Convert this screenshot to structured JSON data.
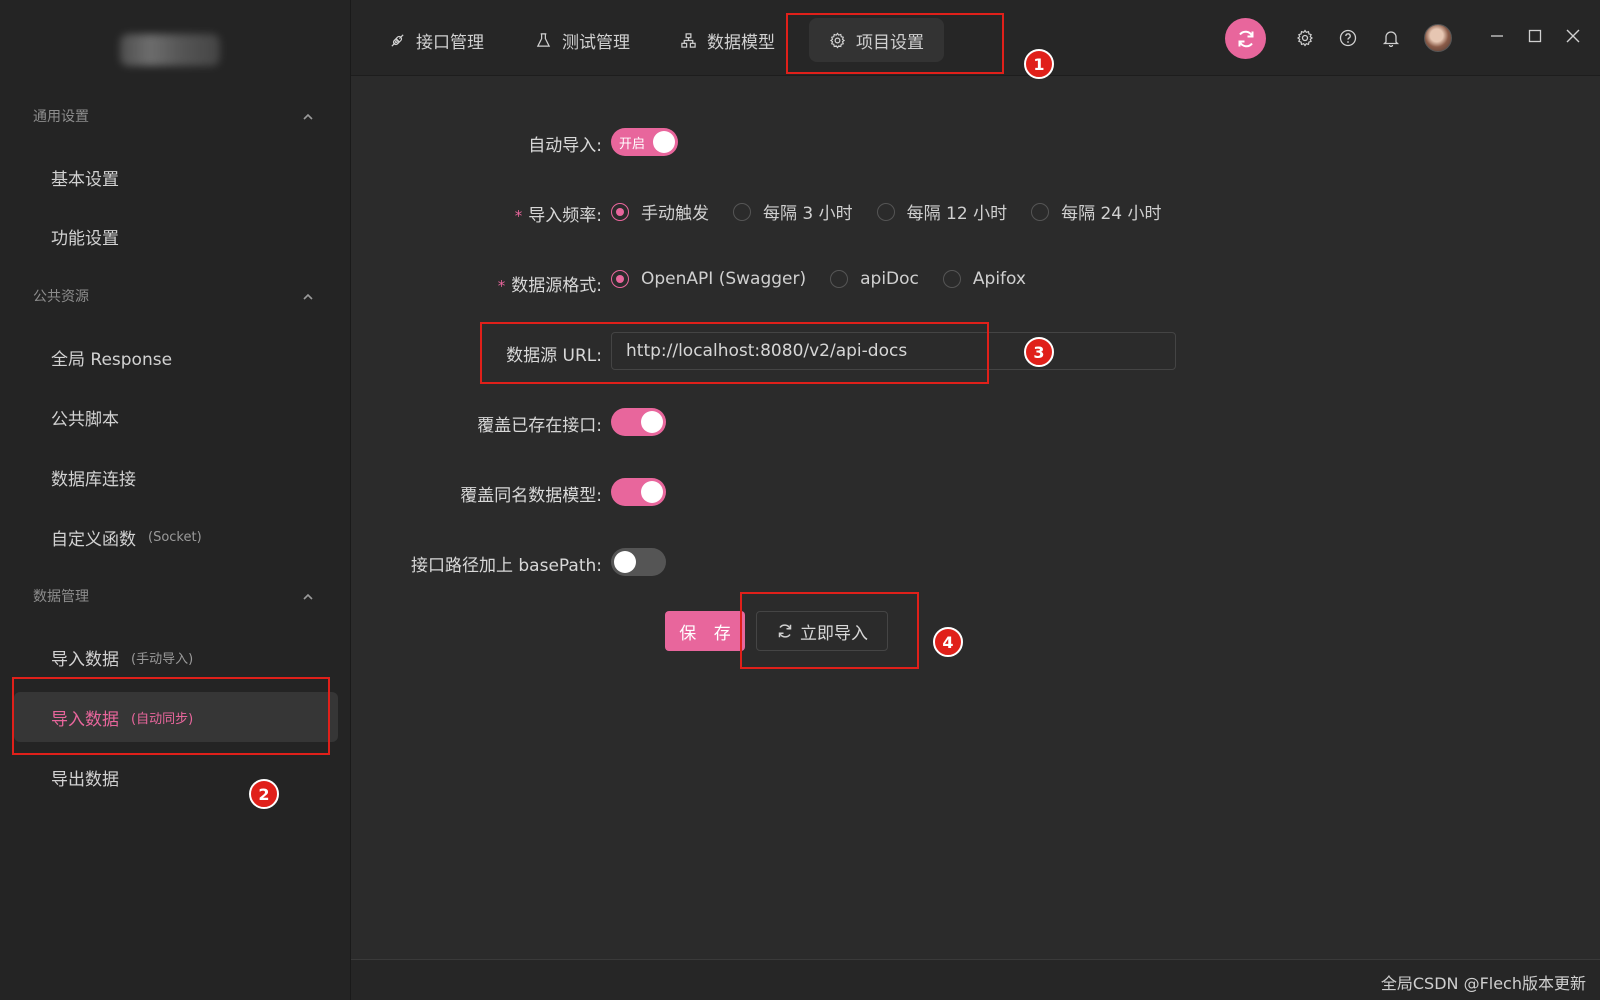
{
  "sidebar": {
    "groups": [
      {
        "title": "通用设置"
      },
      {
        "title": "公共资源"
      },
      {
        "title": "数据管理"
      }
    ],
    "items": [
      {
        "label": "基本设置",
        "sub": ""
      },
      {
        "label": "功能设置",
        "sub": ""
      },
      {
        "label": "全局 Response",
        "sub": ""
      },
      {
        "label": "公共脚本",
        "sub": ""
      },
      {
        "label": "数据库连接",
        "sub": ""
      },
      {
        "label": "自定义函数",
        "sub": "(Socket)"
      },
      {
        "label": "导入数据",
        "sub": "(手动导入)"
      },
      {
        "label": "导入数据",
        "sub": "(自动同步)"
      },
      {
        "label": "导出数据",
        "sub": ""
      }
    ]
  },
  "tabs": [
    {
      "label": "接口管理",
      "icon": "api-icon"
    },
    {
      "label": "测试管理",
      "icon": "flask-icon"
    },
    {
      "label": "数据模型",
      "icon": "model-icon"
    },
    {
      "label": "项目设置",
      "icon": "gear-icon"
    }
  ],
  "form": {
    "auto_import_label": "自动导入:",
    "auto_import_switch_text": "开启",
    "frequency_label": "导入频率:",
    "frequency_options": [
      "手动触发",
      "每隔 3 小时",
      "每隔 12 小时",
      "每隔 24 小时"
    ],
    "format_label": "数据源格式:",
    "format_options": [
      "OpenAPI (Swagger)",
      "apiDoc",
      "Apifox"
    ],
    "url_label": "数据源 URL:",
    "url_value": "http://localhost:8080/v2/api-docs",
    "override_api_label": "覆盖已存在接口:",
    "override_model_label": "覆盖同名数据模型:",
    "base_path_label": "接口路径加上 basePath:",
    "save_label": "保 存",
    "import_now_label": "立即导入"
  },
  "annotations": [
    "1",
    "2",
    "3",
    "4"
  ],
  "watermark": "全局CSDN @Flech版本更新",
  "colors": {
    "accent": "#e8669c",
    "annotation": "#e0201a"
  }
}
